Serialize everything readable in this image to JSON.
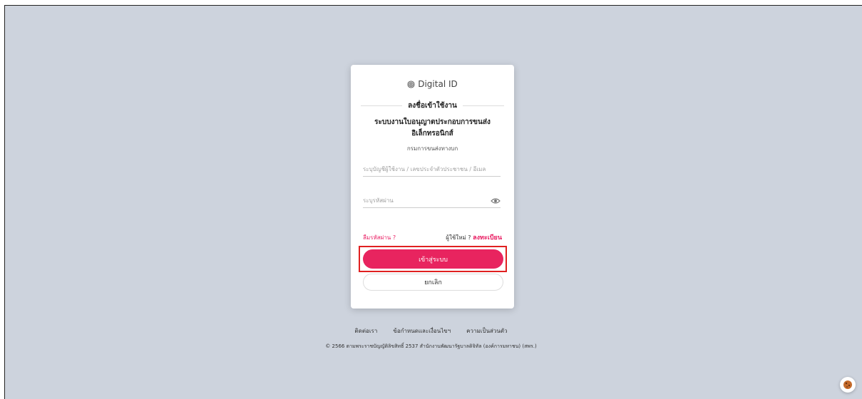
{
  "brand": {
    "name": "Digital ID",
    "icon": "fingerprint-icon"
  },
  "login": {
    "heading": "ลงชื่อเข้าใช้งาน",
    "system_title_line1": "ระบบงานใบอนุญาตประกอบการขนส่ง",
    "system_title_line2": "อิเล็กทรอนิกส์",
    "department": "กรมการขนส่งทางบก",
    "username_placeholder": "ระบุบัญชีผู้ใช้งาน / เลขประจำตัวประชาชน / อีเมล",
    "username_value": "",
    "password_placeholder": "ระบุรหัสผ่าน",
    "password_value": "",
    "forgot_password": "ลืมรหัสผ่าน ?",
    "new_user": "ผู้ใช้ใหม่ ?",
    "register": "ลงทะเบียน",
    "login_button": "เข้าสู่ระบบ",
    "cancel_button": "ยกเลิก"
  },
  "footer": {
    "links": [
      "ติดต่อเรา",
      "ข้อกำหนดและเงื่อนไขฯ",
      "ความเป็นส่วนตัว"
    ],
    "copyright": "© 2566 ตามพระราชบัญญัติลิขสิทธิ์ 2537 สำนักงานพัฒนารัฐบาลดิจิทัล (องค์การมหาชน) (สพร.)"
  },
  "colors": {
    "accent": "#e8245f",
    "background": "#cdd3dd",
    "highlight": "#e02020"
  },
  "icons": {
    "password_toggle": "eye-icon",
    "corner": "cookie-icon"
  }
}
